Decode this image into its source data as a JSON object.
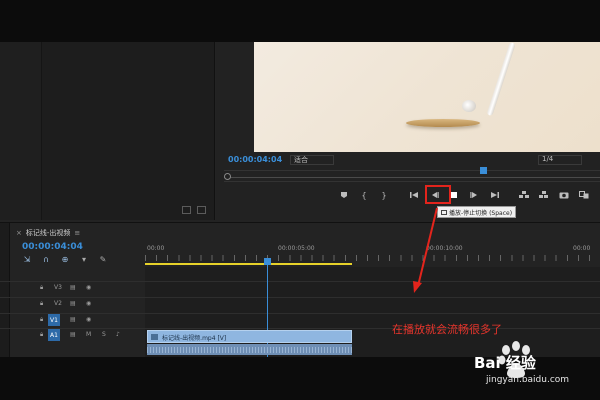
{
  "program_monitor": {
    "timecode": "00:00:04:04",
    "fit_label": "适合",
    "quarter_label": "1/4",
    "transport": [
      "mark-in-icon",
      "mark-out-icon",
      "go-to-in-icon",
      "step-back-icon",
      "stop-icon",
      "step-forward-icon",
      "go-to-out-icon",
      "lift-icon",
      "extract-icon",
      "export-frame-icon",
      "compare-icon"
    ],
    "tooltip": "播放-停止切换 (Space)",
    "brackets": [
      "{",
      "}"
    ]
  },
  "timeline": {
    "tab_title": "标记线-出视频",
    "timecode": "00:00:04:04",
    "ruler_labels": [
      "00:00",
      "00:00:05:00",
      "00:00:10:00",
      "00:00"
    ],
    "tracks": [
      {
        "name": "V3"
      },
      {
        "name": "V2"
      },
      {
        "name": "V1",
        "src": "V1"
      },
      {
        "name": "A1",
        "src": "A1",
        "m": "M",
        "s": "S"
      }
    ],
    "clip_name": "标记线-出视频.mp4 [V]"
  },
  "annotation": "在播放就会流畅很多了",
  "watermark": {
    "brand": "Bai 经验",
    "url": "jingyan.baidu.com"
  },
  "colors": {
    "accent_blue": "#3a8ed8",
    "highlight_red": "#e3241c",
    "annotation_red": "#e8352c",
    "work_area_yellow": "#e7d22a",
    "clip_blue": "#8fb6e0"
  }
}
